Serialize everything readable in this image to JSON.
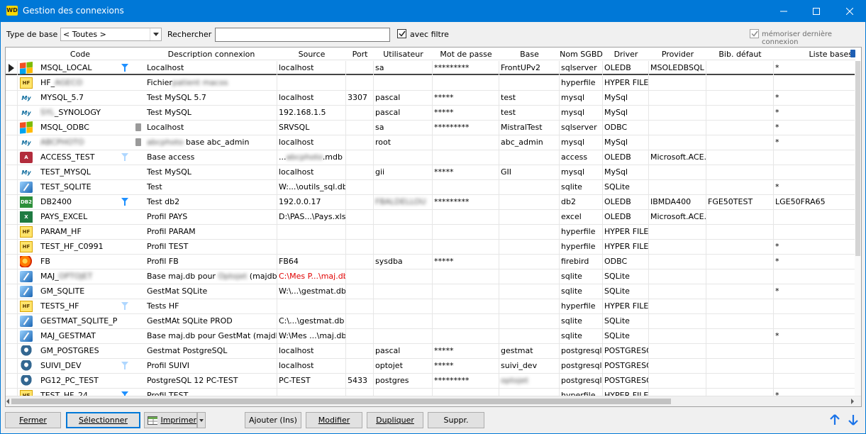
{
  "window": {
    "title": "Gestion des connexions",
    "icon_text": "WD",
    "controls": [
      "minimize-icon",
      "maximize-icon",
      "close-icon"
    ]
  },
  "filters": {
    "type_label": "Type de base",
    "type_value": "< Toutes >",
    "search_label": "Rechercher",
    "search_value": "",
    "filter_label": "avec filtre",
    "filter_checked": true,
    "memo_label": "mémoriser dernière connexion",
    "memo_checked": true
  },
  "columns": [
    "Code",
    "",
    "",
    "Description connexion",
    "Source",
    "Port",
    "Utilisateur",
    "Mot de passe",
    "Base",
    "Nom SGBD",
    "Driver",
    "Provider",
    "Bib. défaut",
    "Liste bases"
  ],
  "rows": [
    {
      "icon": "windows-icon",
      "code": "MSQL_LOCAL",
      "filter": "on",
      "trash": false,
      "desc": "Localhost",
      "source": "localhost",
      "port": "",
      "user": "sa",
      "pwd": "*********",
      "base": "FrontUPv2",
      "sgbd": "sqlserver",
      "driver": "OLEDB",
      "provider": "MSOLEDBSQL",
      "bib": "",
      "liste": "*",
      "selected": true
    },
    {
      "icon": "hf-icon",
      "code": "HF_",
      "code_blur": "AGECO",
      "filter": "",
      "trash": false,
      "desc": "Fichier",
      "desc_blur": "patient macos",
      "source": "",
      "port": "",
      "user": "",
      "pwd": "",
      "base": "",
      "sgbd": "hyperfile",
      "driver": "HYPER FILE",
      "provider": "",
      "bib": "",
      "liste": ""
    },
    {
      "icon": "mysql-icon",
      "code": "MYSQL_5.7",
      "filter": "",
      "trash": false,
      "desc": "Test MySQL 5.7",
      "source": "localhost",
      "port": "3307",
      "user": "pascal",
      "pwd": "*****",
      "base": "test",
      "sgbd": "mysql",
      "driver": "MySql",
      "provider": "",
      "bib": "",
      "liste": "*"
    },
    {
      "icon": "mysql-icon",
      "code_blur_pre": "SYL",
      "code": "_SYNOLOGY",
      "filter": "",
      "trash": false,
      "desc": "Test MySQL",
      "source": "192.168.1.5",
      "port": "",
      "user": "pascal",
      "pwd": "*****",
      "base": "test",
      "sgbd": "mysql",
      "driver": "MySql",
      "provider": "",
      "bib": "",
      "liste": "*"
    },
    {
      "icon": "windows-icon",
      "code": "MSQL_ODBC",
      "filter": "",
      "trash": true,
      "desc": "Localhost",
      "source": "SRVSQL",
      "port": "",
      "user": "sa",
      "pwd": "*********",
      "base": "MistralTest",
      "sgbd": "sqlserver",
      "driver": "ODBC",
      "provider": "",
      "bib": "",
      "liste": "*"
    },
    {
      "icon": "mysql-icon",
      "code": "",
      "code_blur": "ABCPHOTO",
      "filter": "",
      "trash": true,
      "desc_blur_pre": "abcphoto",
      "desc": " base abc_admin",
      "source": "localhost",
      "port": "",
      "user": "root",
      "pwd": "",
      "base": "abc_admin",
      "sgbd": "mysql",
      "driver": "MySql",
      "provider": "",
      "bib": "",
      "liste": "*"
    },
    {
      "icon": "access-icon",
      "code": "ACCESS_TEST",
      "filter": "faint",
      "trash": false,
      "desc": "Base access",
      "source": "...",
      "source_blur": "abcphoto",
      "source_post": ".mdb",
      "port": "",
      "user": "",
      "pwd": "",
      "base": "",
      "sgbd": "access",
      "driver": "OLEDB",
      "provider": "Microsoft.ACE.O",
      "bib": "",
      "liste": ""
    },
    {
      "icon": "mysql-icon",
      "code": "TEST_MYSQL",
      "filter": "",
      "trash": false,
      "desc": "Test MySQL",
      "source": "localhost",
      "port": "",
      "user": "gii",
      "pwd": "*****",
      "base": "GII",
      "sgbd": "mysql",
      "driver": "MySql",
      "provider": "",
      "bib": "",
      "liste": ""
    },
    {
      "icon": "sqlite-icon",
      "code": "TEST_SQLITE",
      "filter": "",
      "trash": false,
      "desc": "Test",
      "source": "W:...\\outils_sql.db",
      "port": "",
      "user": "",
      "pwd": "",
      "base": "",
      "sgbd": "sqlite",
      "driver": "SQLite",
      "provider": "",
      "bib": "",
      "liste": "*"
    },
    {
      "icon": "db2-icon",
      "code": "DB2400",
      "filter": "on",
      "trash": false,
      "desc": "Test db2",
      "source": "192.0.0.17",
      "port": "",
      "user": "",
      "user_blur": "FBALDELLOU",
      "pwd": "*********",
      "base": "",
      "sgbd": "db2",
      "driver": "OLEDB",
      "provider": "IBMDA400",
      "bib": "FGE50TEST",
      "liste": "LGE50FRA65"
    },
    {
      "icon": "excel-icon",
      "code": "PAYS_EXCEL",
      "filter": "",
      "trash": false,
      "desc": "Profil PAYS",
      "source": "D:\\PAS...\\Pays.xlsx",
      "port": "",
      "user": "",
      "pwd": "",
      "base": "",
      "sgbd": "excel",
      "driver": "OLEDB",
      "provider": "Microsoft.ACE.O",
      "bib": "",
      "liste": ""
    },
    {
      "icon": "hf-icon",
      "code": "PARAM_HF",
      "filter": "",
      "trash": false,
      "desc": "Profil PARAM",
      "source": "",
      "port": "",
      "user": "",
      "pwd": "",
      "base": "",
      "sgbd": "hyperfile",
      "driver": "HYPER FILE",
      "provider": "",
      "bib": "",
      "liste": ""
    },
    {
      "icon": "hf-icon",
      "code": "TEST_HF_C0991",
      "filter": "",
      "trash": false,
      "desc": "Profil TEST",
      "source": "",
      "port": "",
      "user": "",
      "pwd": "",
      "base": "",
      "sgbd": "hyperfile",
      "driver": "HYPER FILE",
      "provider": "",
      "bib": "",
      "liste": "*"
    },
    {
      "icon": "firebird-icon",
      "code": "FB",
      "filter": "",
      "trash": false,
      "desc": "Profil FB",
      "source": "FB64",
      "port": "",
      "user": "sysdba",
      "pwd": "*****",
      "base": "",
      "sgbd": "firebird",
      "driver": "ODBC",
      "provider": "",
      "bib": "",
      "liste": "*"
    },
    {
      "icon": "sqlite-icon",
      "code": "MAJ_",
      "code_blur": "OPTOJET",
      "filter": "",
      "trash": false,
      "desc": "Base maj.db pour ",
      "desc_blur": "Optojet",
      "desc_post": " (majdb)",
      "source": "C:\\Mes P...\\maj.db",
      "source_red": true,
      "port": "",
      "user": "",
      "pwd": "",
      "base": "",
      "sgbd": "sqlite",
      "driver": "SQLite",
      "provider": "",
      "bib": "",
      "liste": ""
    },
    {
      "icon": "sqlite-icon",
      "code": "GM_SQLITE",
      "filter": "",
      "trash": false,
      "desc": "GestMat SQLite",
      "source": "W:\\...\\gestmat.db",
      "port": "",
      "user": "",
      "pwd": "",
      "base": "",
      "sgbd": "sqlite",
      "driver": "SQLite",
      "provider": "",
      "bib": "",
      "liste": "*"
    },
    {
      "icon": "hf-icon",
      "code": "TESTS_HF",
      "filter": "faint",
      "trash": false,
      "desc": "Tests HF",
      "source": "",
      "port": "",
      "user": "",
      "pwd": "",
      "base": "",
      "sgbd": "hyperfile",
      "driver": "HYPER FILE",
      "provider": "",
      "bib": "",
      "liste": ""
    },
    {
      "icon": "sqlite-icon",
      "code": "GESTMAT_SQLITE_PRO",
      "filter": "",
      "trash": false,
      "desc": "GestMAt SQLite PROD",
      "source": "C:\\...\\gestmat.db",
      "port": "",
      "user": "",
      "pwd": "",
      "base": "",
      "sgbd": "sqlite",
      "driver": "SQLite",
      "provider": "",
      "bib": "",
      "liste": ""
    },
    {
      "icon": "sqlite-icon",
      "code": "MAJ_GESTMAT",
      "filter": "",
      "trash": false,
      "desc": "Base maj.db pour GestMat (majdb)",
      "source": "W:\\Mes ...\\maj.db",
      "port": "",
      "user": "",
      "pwd": "",
      "base": "",
      "sgbd": "sqlite",
      "driver": "SQLite",
      "provider": "",
      "bib": "",
      "liste": "*"
    },
    {
      "icon": "postgres-icon",
      "code": "GM_POSTGRES",
      "filter": "",
      "trash": false,
      "desc": "Gestmat PostgreSQL",
      "source": "localhost",
      "port": "",
      "user": "pascal",
      "pwd": "*****",
      "base": "gestmat",
      "sgbd": "postgresql",
      "driver": "POSTGRESQL",
      "provider": "",
      "bib": "",
      "liste": ""
    },
    {
      "icon": "postgres-icon",
      "code": "SUIVI_DEV",
      "filter": "faint",
      "trash": false,
      "desc": "Profil SUIVI",
      "source": "localhost",
      "port": "",
      "user": "optojet",
      "pwd": "*****",
      "base": "suivi_dev",
      "sgbd": "postgresql",
      "driver": "POSTGRESQL",
      "provider": "",
      "bib": "",
      "liste": ""
    },
    {
      "icon": "postgres-icon",
      "code": "PG12_PC_TEST",
      "filter": "",
      "trash": false,
      "desc": "PostgreSQL 12 PC-TEST",
      "source": "PC-TEST",
      "port": "5433",
      "user": "postgres",
      "pwd": "*********",
      "base": "",
      "base_blur": "optojet",
      "sgbd": "postgresql",
      "driver": "POSTGRESQL",
      "provider": "",
      "bib": "",
      "liste": ""
    },
    {
      "icon": "hf-icon",
      "code": "TEST_HF_24",
      "filter": "on",
      "trash": false,
      "desc": "Profil TEST",
      "source": "",
      "port": "",
      "user": "",
      "pwd": "",
      "base": "",
      "sgbd": "hyperfile",
      "driver": "HYPER FILE",
      "provider": "",
      "bib": "",
      "liste": "*"
    }
  ],
  "buttons": {
    "fermer": "Fermer",
    "selectionner": "Sélectionner",
    "imprimer": "Imprimer",
    "ajouter": "Ajouter (Ins)",
    "modifier": "Modifier",
    "dupliquer": "Dupliquer",
    "suppr": "Suppr."
  },
  "colors": {
    "accent": "#0078d7",
    "filter_icon": "#1e90ff",
    "red_path": "#e00000"
  }
}
